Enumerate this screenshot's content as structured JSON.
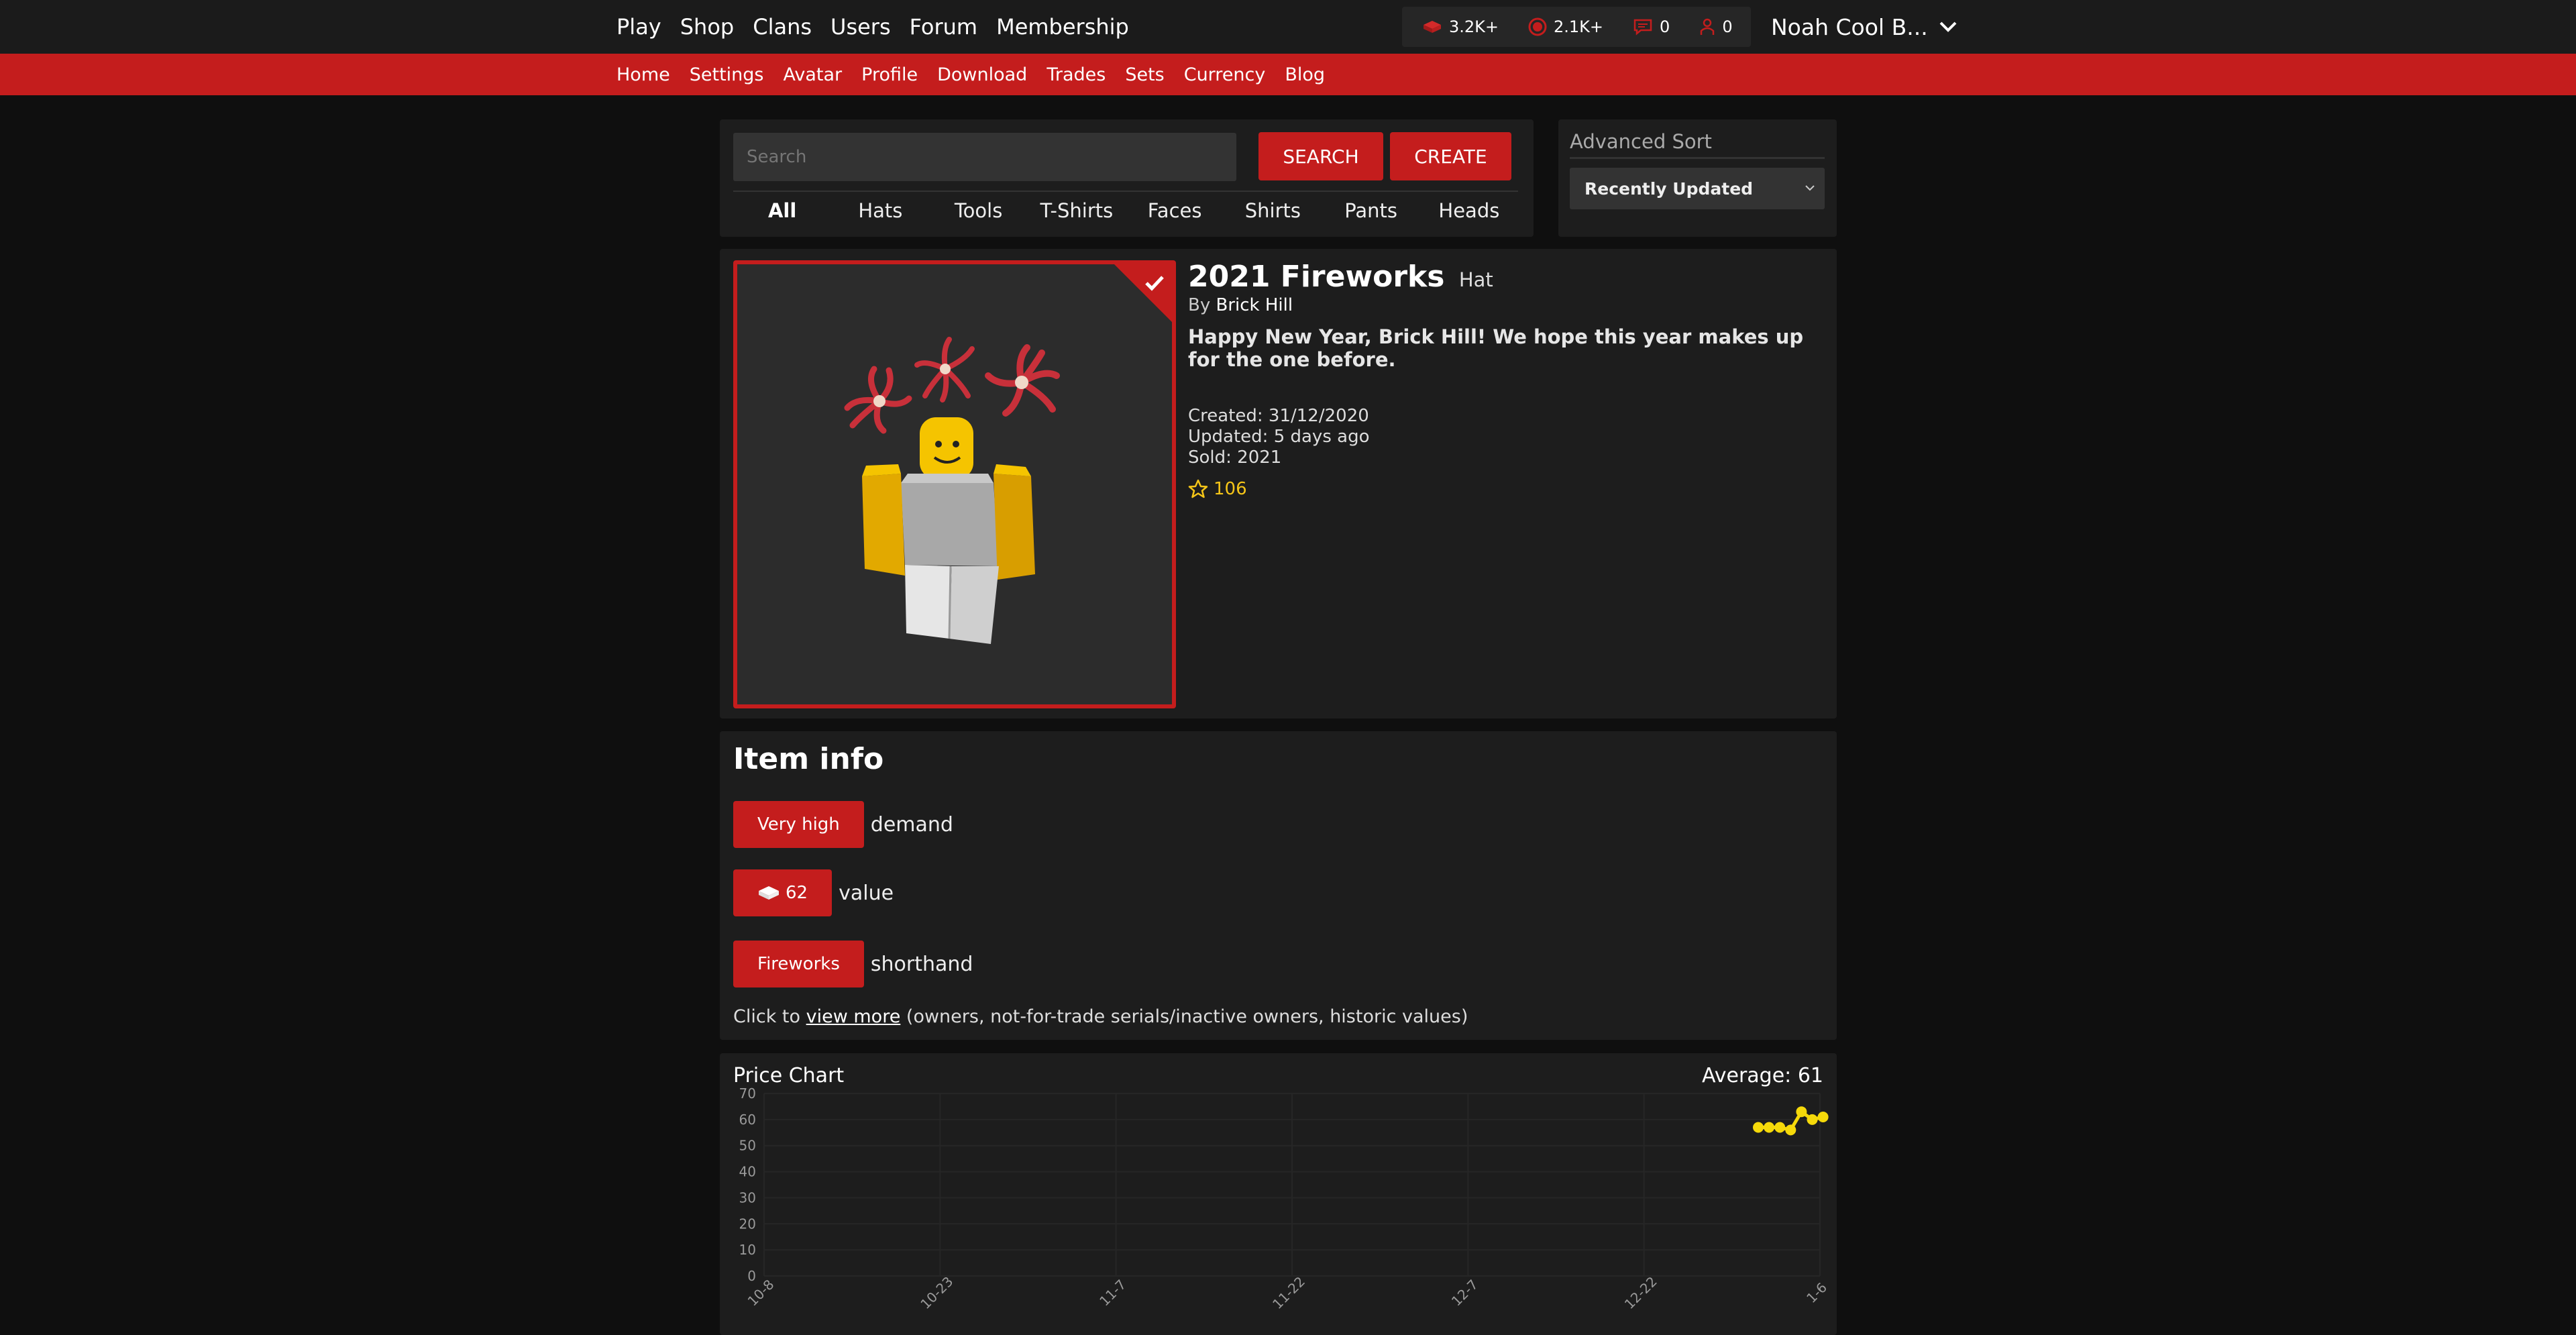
{
  "nav": {
    "main": [
      "Play",
      "Shop",
      "Clans",
      "Users",
      "Forum",
      "Membership"
    ],
    "sub": [
      "Home",
      "Settings",
      "Avatar",
      "Profile",
      "Download",
      "Trades",
      "Sets",
      "Currency",
      "Blog"
    ]
  },
  "stats": {
    "bricks": "3.2K+",
    "bucks": "2.1K+",
    "messages": "0",
    "friend_requests": "0"
  },
  "user": {
    "name": "Noah Cool B..."
  },
  "search": {
    "placeholder": "Search",
    "search_label": "SEARCH",
    "create_label": "CREATE",
    "categories": [
      "All",
      "Hats",
      "Tools",
      "T-Shirts",
      "Faces",
      "Shirts",
      "Pants",
      "Heads"
    ],
    "active_category": "All"
  },
  "sort": {
    "title": "Advanced Sort",
    "selected": "Recently Updated"
  },
  "item": {
    "name": "2021 Fireworks",
    "type": "Hat",
    "by_prefix": "By",
    "creator": "Brick Hill",
    "description": "Happy New Year, Brick Hill! We hope this year makes up for the one before.",
    "created": "Created: 31/12/2020",
    "updated": "Updated: 5 days ago",
    "sold": "Sold: 2021",
    "favorites": "106"
  },
  "info": {
    "title": "Item info",
    "demand_value": "Very high",
    "demand_label": "demand",
    "value_value": "62",
    "value_label": "value",
    "shorthand_value": "Fireworks",
    "shorthand_label": "shorthand",
    "more_prefix": "Click to",
    "more_link": "view more",
    "more_suffix": "(owners, not-for-trade serials/inactive owners, historic values)"
  },
  "chart_data": {
    "type": "line",
    "title": "Price Chart",
    "average_label": "Average: 61",
    "ylim": [
      0,
      70
    ],
    "yticks": [
      0,
      10,
      20,
      30,
      40,
      50,
      60,
      70
    ],
    "xticks": [
      "10-8",
      "10-23",
      "11-7",
      "11-22",
      "12-7",
      "12-22",
      "1-6"
    ],
    "grid": true,
    "line_color": "#f5d90a",
    "points": [
      {
        "x": "1-4",
        "y": 57
      },
      {
        "x": "1-5",
        "y": 57
      },
      {
        "x": "1-5",
        "y": 57
      },
      {
        "x": "1-5",
        "y": 56
      },
      {
        "x": "1-6",
        "y": 63
      },
      {
        "x": "1-6",
        "y": 60
      },
      {
        "x": "1-7",
        "y": 61
      }
    ]
  },
  "colors": {
    "accent": "#c41d1d",
    "star": "#f5c518"
  }
}
